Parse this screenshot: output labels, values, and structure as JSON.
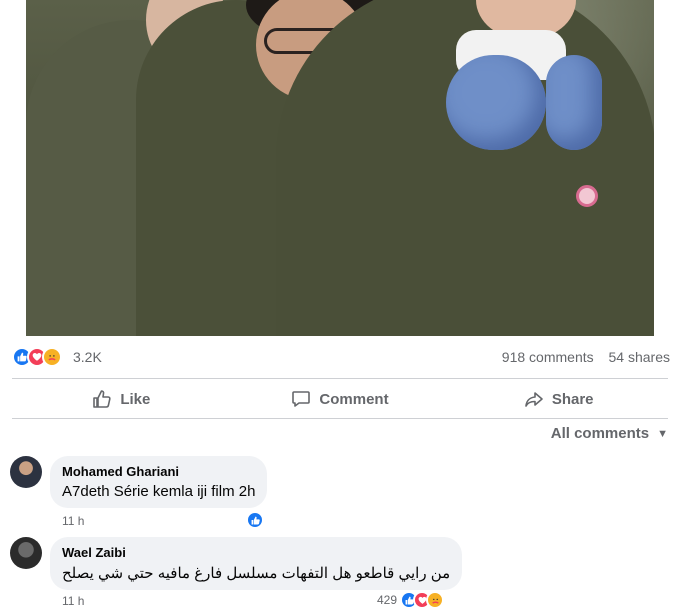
{
  "post": {
    "reactions_count": "3.2K",
    "comments_count": "918 comments",
    "shares_count": "54 shares"
  },
  "actions": {
    "like": "Like",
    "comment": "Comment",
    "share": "Share"
  },
  "comments_filter": "All comments",
  "comments": [
    {
      "author": "Mohamed Ghariani",
      "text": "A7deth Série kemla iji film 2h",
      "time": "11 h",
      "reaction_count": ""
    },
    {
      "author": "Wael Zaibi",
      "text": "من رايي قاطعو هل التفهات مسلسل فارغ مافيه حتي شي يصلح",
      "time": "11 h",
      "reaction_count": "429"
    }
  ],
  "icons": {
    "like": "thumbs-up-icon",
    "love": "heart-icon",
    "care": "care-face-icon"
  },
  "colors": {
    "like": "#1877f2",
    "love": "#f33e58",
    "care": "#f7b125",
    "secondary_text": "#65676b",
    "bubble": "#f0f2f5"
  }
}
